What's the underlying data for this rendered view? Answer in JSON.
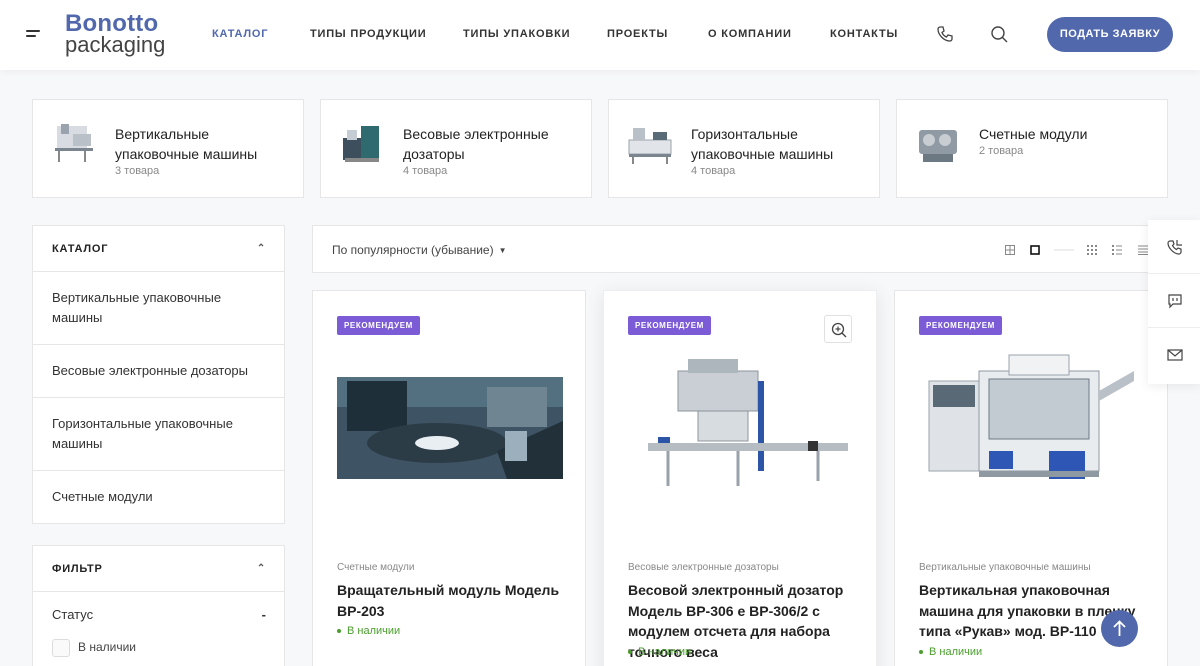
{
  "header": {
    "logo_line1": "Bonotto",
    "logo_line2": "packaging",
    "nav": [
      "КАТАЛОГ",
      "ТИПЫ ПРОДУКЦИИ",
      "ТИПЫ УПАКОВКИ",
      "ПРОЕКТЫ",
      "О КОМПАНИИ",
      "КОНТАКТЫ"
    ],
    "cta": "ПОДАТЬ ЗАЯВКУ"
  },
  "categories": [
    {
      "name": "Вертикальные упаковочные машины",
      "count": "3 товара"
    },
    {
      "name": "Весовые электронные дозаторы",
      "count": "4 товара"
    },
    {
      "name": "Горизонтальные упаковочные машины",
      "count": "4 товара"
    },
    {
      "name": "Счетные модули",
      "count": "2 товара"
    }
  ],
  "sidebar": {
    "catalog_title": "КАТАЛОГ",
    "items": [
      "Вертикальные упаковочные машины",
      "Весовые электронные дозаторы",
      "Горизонтальные упаковочные машины",
      "Счетные модули"
    ],
    "filter_title": "ФИЛЬТР",
    "status_label": "Статус",
    "in_stock": "В наличии"
  },
  "sort": {
    "label": "По популярности (убывание)"
  },
  "products": [
    {
      "badge": "РЕКОМЕНДУЕМ",
      "category": "Счетные модули",
      "title": "Вращательный модуль Модель BP-203",
      "stock": "В наличии"
    },
    {
      "badge": "РЕКОМЕНДУЕМ",
      "category": "Весовые электронные дозаторы",
      "title": "Весовой электронный дозатор Модель BP-306 e BP-306/2 с модулем отсчета для набора точного веса",
      "stock": "В наличии"
    },
    {
      "badge": "РЕКОМЕНДУЕМ",
      "category": "Вертикальные упаковочные машины",
      "title": "Вертикальная упаковочная машина для упаковки в пленку типа «Рукав» мод. BP-110",
      "stock": "В наличии"
    }
  ],
  "colors": {
    "accent": "#5168ad",
    "badge": "#7b5bd6",
    "stock": "#4b9e2e"
  }
}
